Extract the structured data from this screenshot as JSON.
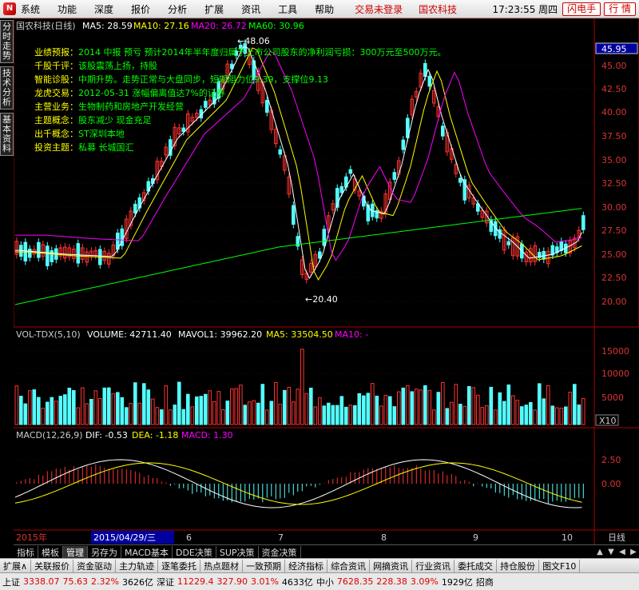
{
  "menu": {
    "items": [
      "系统",
      "功能",
      "深度",
      "报价",
      "分析",
      "扩展",
      "资讯",
      "工具",
      "帮助"
    ],
    "trade_status": "交易未登录",
    "stock_name": "国农科技",
    "time": "17:23:55 周四",
    "btn_flash": "闪电手",
    "btn_quote": "行 情"
  },
  "side_tabs": [
    "分时走势",
    "技术分析",
    "基本资料"
  ],
  "price_panel": {
    "header_title": "国农科技(日线)",
    "ma5": "MA5: 28.59",
    "ma10": "MA10: 27.16",
    "ma20": "MA20: 26.72",
    "ma60": "MA60: 30.96",
    "current_price_tag": "45.95",
    "high_label": "48.06",
    "low_label": "20.40",
    "axis": [
      "45.00",
      "42.50",
      "40.00",
      "37.50",
      "35.00",
      "32.50",
      "30.00",
      "27.50",
      "25.00",
      "22.50",
      "20.00"
    ],
    "info": [
      {
        "k": "业绩预报：",
        "v": "2014 中报 预亏 预计2014年半年度归属于上市公司股东的净利润亏损：300万元至500万元。"
      },
      {
        "k": "千股千评：",
        "v": "该股震荡上扬，持股"
      },
      {
        "k": "智能诊股：",
        "v": "中期升势。走势正常与大盘同步，短期阻力位9.39，支撑位9.13"
      },
      {
        "k": "龙虎交易：",
        "v": "2012-05-31 涨幅偏离值达7%的证券"
      },
      {
        "k": "主营业务：",
        "v": "生物制药和房地产开发经营"
      },
      {
        "k": "主题概念：",
        "v": "股东减少 现金充足"
      },
      {
        "k": "出千概念：",
        "v": "ST深圳本地"
      },
      {
        "k": "投资主题：",
        "v": "私募 长城国汇"
      }
    ]
  },
  "vol_panel": {
    "title": "VOL-TDX(5,10)",
    "volume": "VOLUME: 42711.40",
    "mavol1": "MAVOL1: 39962.20",
    "ma5": "MA5: 33504.50",
    "ma10": "MA10: -",
    "axis": [
      "15000",
      "10000",
      "5000"
    ],
    "unit": "X10"
  },
  "macd_panel": {
    "title": "MACD(12,26,9)",
    "dif": "DIF: -0.53",
    "dea": "DEA: -1.18",
    "macd": "MACD: 1.30",
    "axis": [
      "2.50",
      "0.00"
    ]
  },
  "date_axis": {
    "year": "2015年",
    "cursor_date": "2015/04/29/三",
    "months": [
      "6",
      "7",
      "8",
      "9",
      "10"
    ],
    "period": "日线"
  },
  "bottom_tabs": [
    "指标",
    "模板",
    "管理",
    "另存为",
    "MACD基本",
    "DDE决策",
    "SUP决策",
    "资金决策"
  ],
  "quote_tabs": [
    "扩展∧",
    "关联报价",
    "资金驱动",
    "主力轨迹",
    "逐笔委托",
    "热点题材",
    "一致预期",
    "经济指标",
    "综合资讯",
    "网摘资讯",
    "行业资讯",
    "委托成交",
    "持仓股份",
    "图文F10"
  ],
  "status": {
    "sh_label": "上证",
    "sh_value": "3338.07",
    "sh_change": "75.63",
    "sh_pct": "2.32%",
    "sh_amount": "3626亿",
    "sz_label": "深证",
    "sz_value": "11229.4",
    "sz_change": "327.90",
    "sz_pct": "3.01%",
    "sz_amount": "4633亿",
    "zx_label": "中小",
    "zx_value": "7628.35",
    "zx_change": "228.38",
    "zx_pct": "3.09%",
    "zx_amount": "1929亿",
    "extra": "招商"
  },
  "colors": {
    "up": "#ff3232",
    "down": "#54ffff",
    "ma5": "#ffffff",
    "ma10": "#ffff00",
    "ma20": "#ff00ff",
    "ma60": "#00ff00",
    "info_key": "#ffff00",
    "info_val": "#00ff00"
  }
}
